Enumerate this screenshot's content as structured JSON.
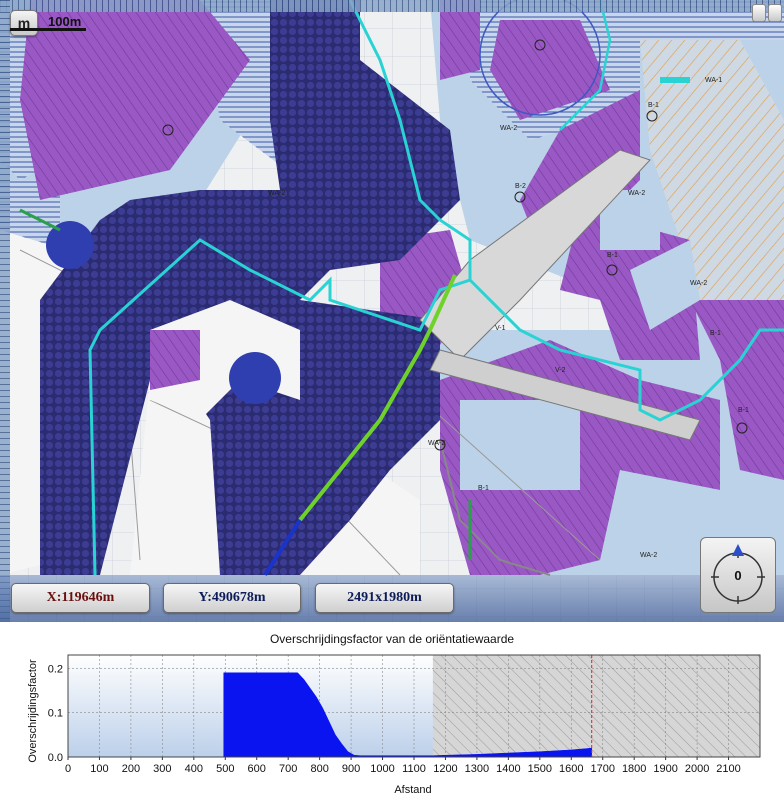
{
  "map": {
    "menu_button_label": "m",
    "scale_label": "100m",
    "x_coordinate": "X:119646m",
    "y_coordinate": "Y:490678m",
    "extent": "2491x1980m",
    "compass_value": "0",
    "zone_labels": [
      "WA-1",
      "WA-2",
      "WA-2",
      "WA-2",
      "WA-2",
      "WA-2",
      "B-1",
      "B-1",
      "B-1",
      "B-1",
      "B-2",
      "V-1",
      "V-2",
      "B-1",
      "WA-2"
    ],
    "colors": {
      "residential_zone": "#9a58c4",
      "water_zone": "#bdd3e6",
      "noise_contour": "#35357e",
      "route_line": "#2ad3d3",
      "selected_route": "#6fd22a",
      "background": "#f2f2f2"
    }
  },
  "chart_data": {
    "type": "area",
    "title": "Overschrijdingsfactor van de oriëntatiewaarde",
    "xlabel": "Afstand",
    "ylabel": "Overschrijdingsfactor",
    "xlim": [
      0,
      2200
    ],
    "ylim": [
      0,
      0.23
    ],
    "x_ticks": [
      "0",
      "100",
      "200",
      "300",
      "400",
      "500",
      "600",
      "700",
      "800",
      "900",
      "1000",
      "1100",
      "1200",
      "1300",
      "1400",
      "1500",
      "1600",
      "1700",
      "1800",
      "1900",
      "2000",
      "2100"
    ],
    "y_ticks": [
      "0.0",
      "0.1",
      "0.2"
    ],
    "grid": true,
    "hatched_range": [
      1160,
      2200
    ],
    "marker_x": 1665,
    "series_color": "#0a14f0",
    "series": [
      {
        "x": [
          0,
          495,
          495,
          730,
          750,
          770,
          790,
          810,
          830,
          850,
          870,
          890,
          910,
          930,
          1000,
          1100,
          1160,
          1200,
          1300,
          1400,
          1500,
          1600,
          1665
        ],
        "values": [
          0,
          0,
          0.19,
          0.19,
          0.175,
          0.155,
          0.135,
          0.11,
          0.08,
          0.05,
          0.03,
          0.012,
          0.004,
          0.003,
          0.003,
          0.003,
          0.003,
          0.004,
          0.006,
          0.009,
          0.012,
          0.016,
          0.02
        ]
      }
    ]
  }
}
